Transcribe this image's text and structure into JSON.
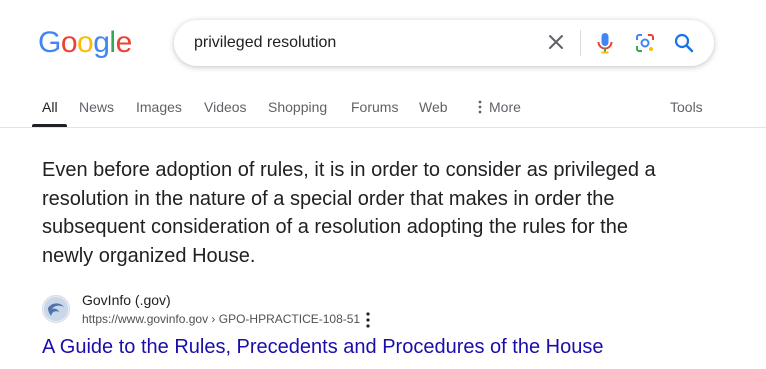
{
  "logo": {
    "letters": [
      "G",
      "o",
      "o",
      "g",
      "l",
      "e"
    ],
    "colors": [
      "#4285F4",
      "#EA4335",
      "#FBBC05",
      "#4285F4",
      "#34A853",
      "#EA4335"
    ]
  },
  "search": {
    "query": "privileged resolution"
  },
  "tabs": [
    {
      "label": "All",
      "active": true
    },
    {
      "label": "News"
    },
    {
      "label": "Images"
    },
    {
      "label": "Videos"
    },
    {
      "label": "Shopping"
    },
    {
      "label": "Forums"
    },
    {
      "label": "Web"
    },
    {
      "label": "More",
      "icon": "vertical-dots-icon"
    },
    {
      "label": "Tools"
    }
  ],
  "snippet": {
    "lines": [
      "Even before adoption of rules, it is in order to consider as privileged a",
      "resolution in the nature of a special order that makes in order the",
      "subsequent consideration of a resolution adopting the rules for the",
      "newly organized House."
    ]
  },
  "result": {
    "site_name": "GovInfo (.gov)",
    "url": "https://www.govinfo.gov › GPO-HPRACTICE-108-51",
    "title": "A Guide to the Rules, Precedents and Procedures of the House",
    "favicon": "govinfo-eagle-icon"
  },
  "colors": {
    "link": "#1a0dab",
    "text": "#202124",
    "muted": "#5f6368",
    "accent": "#1a73e8"
  }
}
